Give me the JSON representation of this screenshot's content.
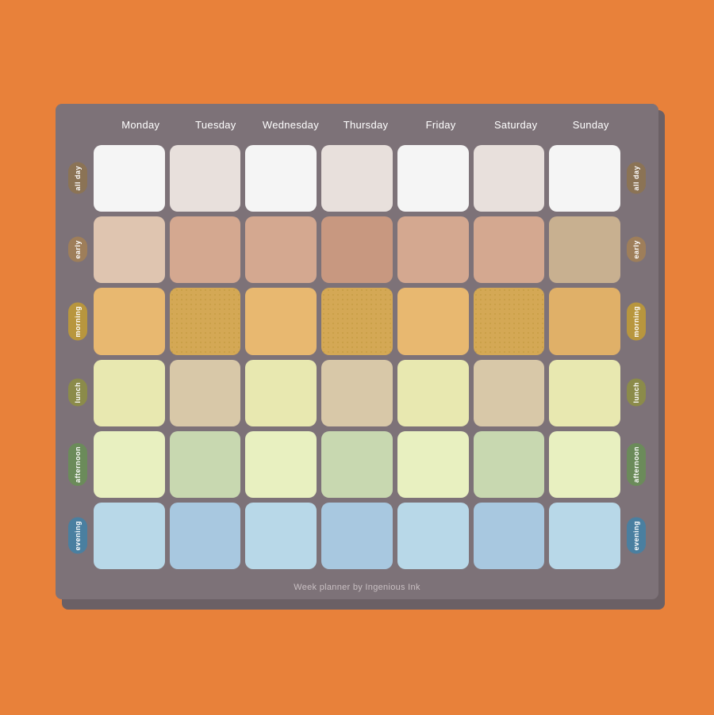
{
  "planner": {
    "title": "Week planner by Ingenious Ink",
    "days": [
      "Monday",
      "Tuesday",
      "Wednesday",
      "Thursday",
      "Friday",
      "Saturday",
      "Sunday"
    ],
    "time_slots": [
      {
        "id": "all-day",
        "label": "all day",
        "pill_class": "all-day-pill"
      },
      {
        "id": "early",
        "label": "early",
        "pill_class": "early-pill"
      },
      {
        "id": "morning",
        "label": "morning",
        "pill_class": "morning-pill"
      },
      {
        "id": "lunch",
        "label": "lunch",
        "pill_class": "lunch-pill"
      },
      {
        "id": "afternoon",
        "label": "afternoon",
        "pill_class": "afternoon-pill"
      },
      {
        "id": "evening",
        "label": "evening",
        "pill_class": "evening-pill"
      }
    ],
    "footer": "Week planner by Ingenious Ink"
  }
}
